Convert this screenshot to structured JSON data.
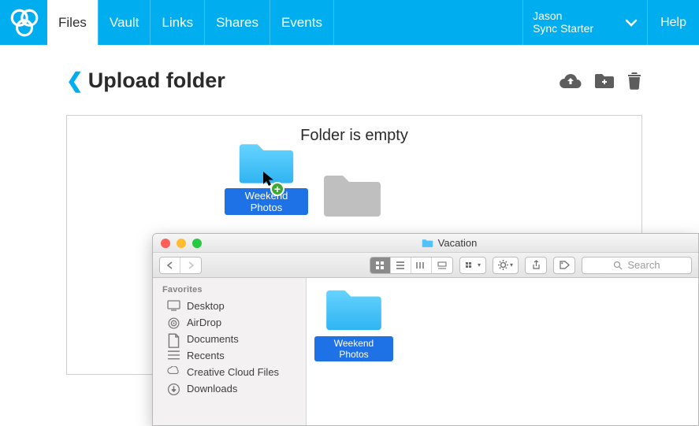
{
  "nav": {
    "items": [
      "Files",
      "Vault",
      "Links",
      "Shares",
      "Events"
    ],
    "active_index": 0
  },
  "user": {
    "name": "Jason",
    "plan": "Sync Starter"
  },
  "help_label": "Help",
  "page": {
    "title": "Upload folder",
    "empty_message": "Folder is empty"
  },
  "drag_preview": {
    "label": "Weekend Photos"
  },
  "finder": {
    "title": "Vacation",
    "search_placeholder": "Search",
    "sidebar": {
      "heading": "Favorites",
      "items": [
        {
          "icon": "desktop",
          "label": "Desktop"
        },
        {
          "icon": "airdrop",
          "label": "AirDrop"
        },
        {
          "icon": "documents",
          "label": "Documents"
        },
        {
          "icon": "recents",
          "label": "Recents"
        },
        {
          "icon": "cc",
          "label": "Creative Cloud Files"
        },
        {
          "icon": "downloads",
          "label": "Downloads"
        }
      ]
    },
    "files": [
      {
        "label": "Weekend Photos"
      }
    ]
  }
}
